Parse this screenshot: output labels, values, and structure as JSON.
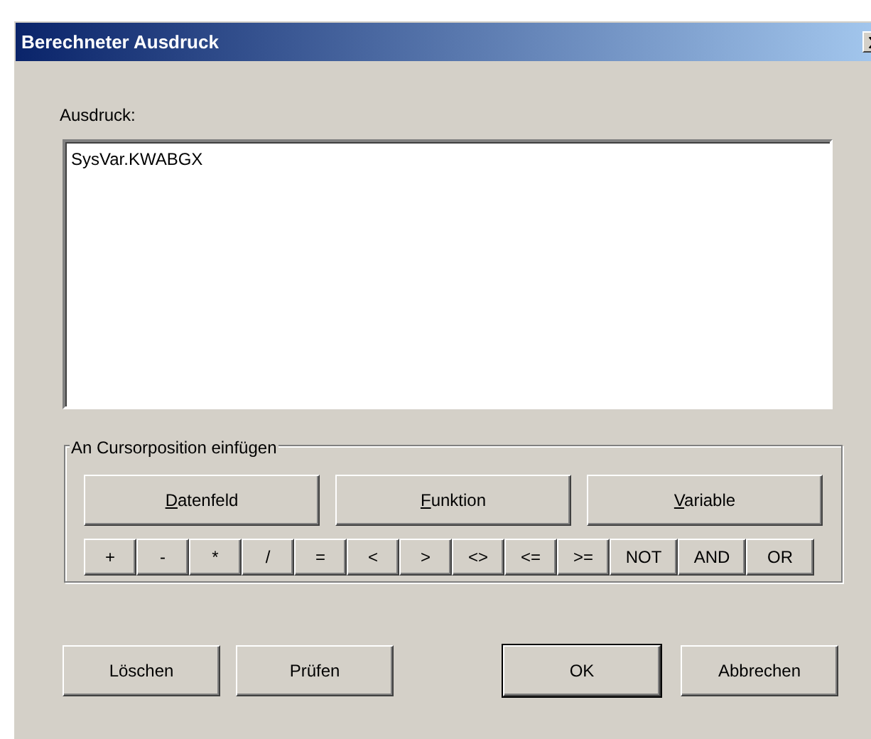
{
  "window": {
    "title": "Berechneter Ausdruck"
  },
  "expression": {
    "label": "Ausdruck:",
    "value": "SysVar.KWABGX"
  },
  "insert_group": {
    "title": "An Cursorposition einfügen",
    "buttons": [
      {
        "label": "Datenfeld",
        "underline_first": true
      },
      {
        "label": "Funktion",
        "underline_first": true
      },
      {
        "label": "Variable",
        "underline_first": true
      }
    ],
    "operators": [
      {
        "label": "+",
        "kind": "narrow"
      },
      {
        "label": "-",
        "kind": "narrow"
      },
      {
        "label": "*",
        "kind": "narrow"
      },
      {
        "label": "/",
        "kind": "narrow"
      },
      {
        "label": "=",
        "kind": "narrow"
      },
      {
        "label": "<",
        "kind": "narrow"
      },
      {
        "label": ">",
        "kind": "narrow"
      },
      {
        "label": "<>",
        "kind": "narrow"
      },
      {
        "label": "<=",
        "kind": "narrow"
      },
      {
        "label": ">=",
        "kind": "narrow"
      },
      {
        "label": "NOT",
        "kind": "wide"
      },
      {
        "label": "AND",
        "kind": "wide"
      },
      {
        "label": "OR",
        "kind": "wide"
      }
    ]
  },
  "footer_left": [
    {
      "label": "Löschen",
      "default": false
    },
    {
      "label": "Prüfen",
      "default": false
    }
  ],
  "footer_right": [
    {
      "label": "OK",
      "default": true
    },
    {
      "label": "Abbrechen",
      "default": false
    }
  ]
}
